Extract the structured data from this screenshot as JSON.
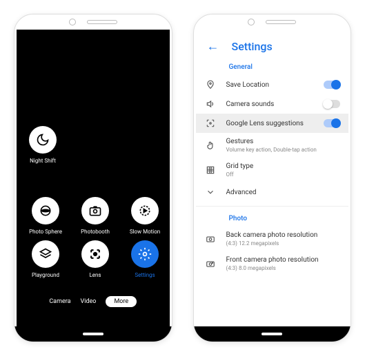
{
  "camera": {
    "nightshift": "Night Shift",
    "items": [
      {
        "label": "Photo Sphere"
      },
      {
        "label": "Photobooth"
      },
      {
        "label": "Slow Motion"
      },
      {
        "label": "Playground"
      },
      {
        "label": "Lens"
      },
      {
        "label": "Settings"
      }
    ],
    "modes": {
      "camera": "Camera",
      "video": "Video",
      "more": "More"
    }
  },
  "settings": {
    "title": "Settings",
    "sections": {
      "general": "General",
      "photo": "Photo"
    },
    "rows": {
      "location": "Save Location",
      "sounds": "Camera sounds",
      "lens": "Google Lens suggestions",
      "gestures": {
        "t": "Gestures",
        "s": "Volume key action, Double-tap action"
      },
      "grid": {
        "t": "Grid type",
        "s": "Off"
      },
      "advanced": "Advanced",
      "back": {
        "t": "Back camera photo resolution",
        "s": "(4:3) 12.2 megapixels"
      },
      "front": {
        "t": "Front camera photo resolution",
        "s": "(4:3) 8.0 megapixels"
      }
    }
  }
}
